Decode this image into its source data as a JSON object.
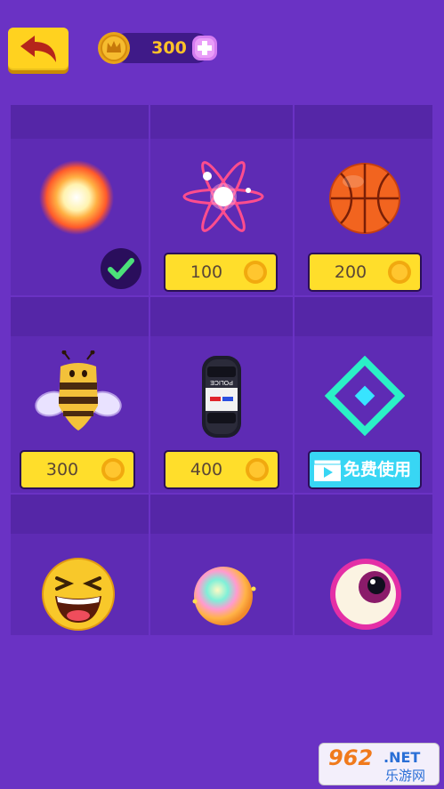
{
  "header": {
    "coin_count": "300",
    "icons": {
      "back": "back-arrow-icon",
      "coin": "crown-coin-icon",
      "add": "plus-icon"
    }
  },
  "skins": [
    {
      "name": "fireball",
      "icon": "fireball-icon",
      "state": "selected"
    },
    {
      "name": "atom",
      "icon": "atom-icon",
      "price": "100"
    },
    {
      "name": "basketball",
      "icon": "basketball-icon",
      "price": "200"
    },
    {
      "name": "bee",
      "icon": "bee-icon",
      "price": "300"
    },
    {
      "name": "police-car",
      "icon": "police-car-icon",
      "price": "400",
      "car_text": "POLICE"
    },
    {
      "name": "neon-diamond",
      "icon": "neon-diamond-icon",
      "video_label": "免费使用"
    },
    {
      "name": "laughing-face",
      "icon": "laughing-face-icon"
    },
    {
      "name": "rainbow-ball",
      "icon": "rainbow-ball-icon"
    },
    {
      "name": "eyeball",
      "icon": "eyeball-icon"
    }
  ],
  "watermark": {
    "main": "962",
    "net": ".NET",
    "sub": "乐游网"
  },
  "colors": {
    "background": "#6a32c4",
    "cell": "#5e2bb4",
    "price_button": "#ffde2b",
    "video_button": "#38d6f4",
    "coin_text": "#ffc229"
  }
}
